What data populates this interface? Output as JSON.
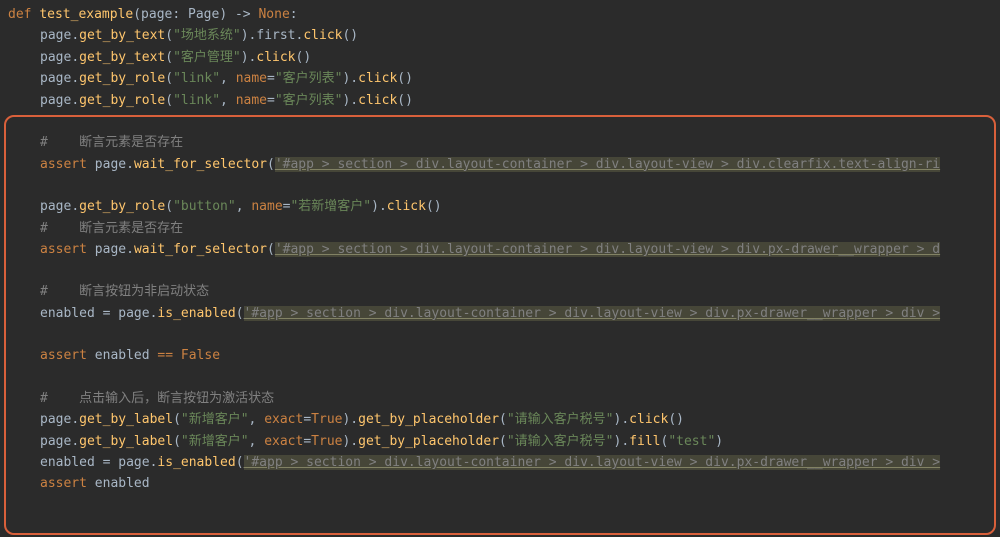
{
  "code": {
    "l01": {
      "def": "def",
      "fn": "test_example",
      "sig": "(page: Page) -> ",
      "none": "None",
      "colon": ":"
    },
    "l02": {
      "obj": "page",
      "m1": "get_by_text",
      "s": "\"场地系统\"",
      "m2": "first",
      "m3": "click"
    },
    "l03": {
      "obj": "page",
      "m1": "get_by_text",
      "s": "\"客户管理\"",
      "m3": "click"
    },
    "l04": {
      "obj": "page",
      "m1": "get_by_role",
      "s1": "\"link\"",
      "kw": "name",
      "s2": "\"客户列表\"",
      "m3": "click"
    },
    "l05": {
      "obj": "page",
      "m1": "get_by_role",
      "s1": "\"link\"",
      "kw": "name",
      "s2": "\"客户列表\"",
      "m3": "click"
    },
    "c1": "#    断言元素是否存在",
    "l06": {
      "kw": "assert",
      "obj": "page",
      "m1": "wait_for_selector",
      "sel": "'#app > section > div.layout-container > div.layout-view > div.clearfix.text-align-ri"
    },
    "l07": {
      "obj": "page",
      "m1": "get_by_role",
      "s1": "\"button\"",
      "kw": "name",
      "s2": "\"若新增客户\"",
      "m3": "click"
    },
    "c2": "#    断言元素是否存在",
    "l08": {
      "kw": "assert",
      "obj": "page",
      "m1": "wait_for_selector",
      "sel": "'#app > section > div.layout-container > div.layout-view > div.px-drawer__wrapper > d"
    },
    "c3": "#    断言按钮为非启动状态",
    "l09": {
      "var": "enabled",
      "obj": "page",
      "m1": "is_enabled",
      "sel": "'#app > section > div.layout-container > div.layout-view > div.px-drawer__wrapper > div >"
    },
    "l10": {
      "kw": "assert",
      "var": "enabled",
      "eq": "==",
      "val": "False"
    },
    "c4": "#    点击输入后，断言按钮为激活状态",
    "l11": {
      "obj": "page",
      "m1": "get_by_label",
      "s1": "\"新增客户\"",
      "kw": "exact",
      "v": "True",
      "m2": "get_by_placeholder",
      "s2": "\"请输入客户税号\"",
      "m3": "click"
    },
    "l12": {
      "obj": "page",
      "m1": "get_by_label",
      "s1": "\"新增客户\"",
      "kw": "exact",
      "v": "True",
      "m2": "get_by_placeholder",
      "s2": "\"请输入客户税号\"",
      "m3": "fill",
      "s3": "\"test\""
    },
    "l13": {
      "var": "enabled",
      "obj": "page",
      "m1": "is_enabled",
      "sel": "'#app > section > div.layout-container > div.layout-view > div.px-drawer__wrapper > div >"
    },
    "l14": {
      "kw": "assert",
      "var": "enabled"
    }
  }
}
